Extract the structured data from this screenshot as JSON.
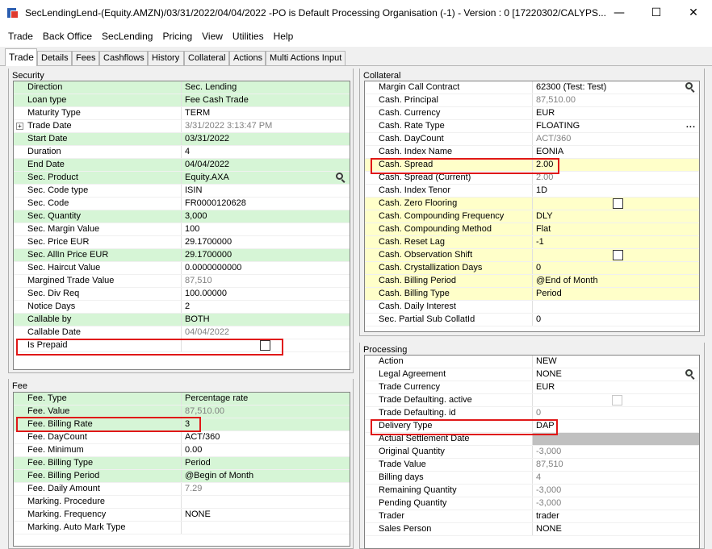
{
  "window": {
    "title": "SecLendingLend-(Equity.AMZN)/03/31/2022/04/04/2022  -PO is Default Processing Organisation  (-1) - Version : 0  [17220302/CALYPS...",
    "minimize_glyph": "—",
    "maximize_glyph": "☐",
    "close_glyph": "✕"
  },
  "menu": [
    "Trade",
    "Back Office",
    "SecLending",
    "Pricing",
    "View",
    "Utilities",
    "Help"
  ],
  "tabs": [
    "Trade",
    "Details",
    "Fees",
    "Cashflows",
    "History",
    "Collateral",
    "Actions",
    "Multi Actions Input"
  ],
  "security": {
    "title": "Security",
    "rows": [
      {
        "label": "Direction",
        "value": "Sec. Lending"
      },
      {
        "label": "Loan type",
        "value": "Fee Cash Trade"
      },
      {
        "label": "Maturity Type",
        "value": "TERM"
      },
      {
        "label": "Trade Date",
        "value": "3/31/2022 3:13:47 PM"
      },
      {
        "label": "Start Date",
        "value": "03/31/2022"
      },
      {
        "label": "Duration",
        "value": "4"
      },
      {
        "label": "End Date",
        "value": "04/04/2022"
      },
      {
        "label": "Sec. Product",
        "value": "Equity.AXA"
      },
      {
        "label": "Sec. Code type",
        "value": "ISIN"
      },
      {
        "label": "Sec. Code",
        "value": "FR0000120628"
      },
      {
        "label": "Sec. Quantity",
        "value": "3,000"
      },
      {
        "label": "Sec. Margin Value",
        "value": "100"
      },
      {
        "label": "Sec. Price EUR",
        "value": "29.1700000"
      },
      {
        "label": "Sec. AllIn Price EUR",
        "value": "29.1700000"
      },
      {
        "label": "Sec. Haircut Value",
        "value": "0.0000000000"
      },
      {
        "label": "Margined Trade Value",
        "value": "87,510"
      },
      {
        "label": "Sec. Div Req",
        "value": "100.00000"
      },
      {
        "label": "Notice Days",
        "value": "2"
      },
      {
        "label": "Callable by",
        "value": "BOTH"
      },
      {
        "label": "Callable Date",
        "value": "04/04/2022"
      },
      {
        "label": "Is Prepaid",
        "value": ""
      }
    ],
    "trade_date_expander": "+"
  },
  "fee": {
    "title": "Fee",
    "rows": [
      {
        "label": "Fee. Type",
        "value": "Percentage rate"
      },
      {
        "label": "Fee. Value",
        "value": "87,510.00"
      },
      {
        "label": "Fee. Billing Rate",
        "value": "3"
      },
      {
        "label": "Fee. DayCount",
        "value": "ACT/360"
      },
      {
        "label": "Fee. Minimum",
        "value": "0.00"
      },
      {
        "label": "Fee. Billing Type",
        "value": "Period"
      },
      {
        "label": "Fee. Billing Period",
        "value": "@Begin of Month"
      },
      {
        "label": "Fee. Daily Amount",
        "value": "7.29"
      },
      {
        "label": "Marking. Procedure",
        "value": ""
      },
      {
        "label": "Marking. Frequency",
        "value": "NONE"
      },
      {
        "label": "Marking. Auto Mark Type",
        "value": ""
      }
    ]
  },
  "collateral": {
    "title": "Collateral",
    "rows": [
      {
        "label": "Margin Call Contract",
        "value": "62300 (Test: Test)"
      },
      {
        "label": "Cash. Principal",
        "value": "87,510.00"
      },
      {
        "label": "Cash. Currency",
        "value": "EUR"
      },
      {
        "label": "Cash. Rate Type",
        "value": "FLOATING"
      },
      {
        "label": "Cash. DayCount",
        "value": "ACT/360"
      },
      {
        "label": "Cash. Index Name",
        "value": "EONIA"
      },
      {
        "label": "Cash. Spread",
        "value": "2.00"
      },
      {
        "label": "Cash. Spread (Current)",
        "value": "2.00"
      },
      {
        "label": "Cash. Index Tenor",
        "value": "1D"
      },
      {
        "label": "Cash. Zero Flooring",
        "value": ""
      },
      {
        "label": "Cash. Compounding Frequency",
        "value": "DLY"
      },
      {
        "label": "Cash. Compounding Method",
        "value": "Flat"
      },
      {
        "label": "Cash. Reset Lag",
        "value": "-1"
      },
      {
        "label": "Cash. Observation Shift",
        "value": ""
      },
      {
        "label": "Cash. Crystallization Days",
        "value": "0"
      },
      {
        "label": "Cash. Billing Period",
        "value": "@End of Month"
      },
      {
        "label": "Cash. Billing Type",
        "value": "Period"
      },
      {
        "label": "Cash. Daily Interest",
        "value": ""
      },
      {
        "label": "Sec. Partial Sub CollatId",
        "value": "0"
      }
    ],
    "ellipsis": "..."
  },
  "processing": {
    "title": "Processing",
    "rows": [
      {
        "label": "Action",
        "value": "NEW"
      },
      {
        "label": "Legal Agreement",
        "value": "NONE"
      },
      {
        "label": "Trade Currency",
        "value": "EUR"
      },
      {
        "label": "Trade Defaulting. active",
        "value": ""
      },
      {
        "label": "Trade Defaulting. id",
        "value": "0"
      },
      {
        "label": "Delivery Type",
        "value": "DAP"
      },
      {
        "label": "Actual Settlement Date",
        "value": ""
      },
      {
        "label": "Original Quantity",
        "value": "-3,000"
      },
      {
        "label": "Trade Value",
        "value": "87,510"
      },
      {
        "label": "Billing days",
        "value": "4"
      },
      {
        "label": "Remaining Quantity",
        "value": "-3,000"
      },
      {
        "label": "Pending Quantity",
        "value": "-3,000"
      },
      {
        "label": "Trader",
        "value": "trader"
      },
      {
        "label": "Sales Person",
        "value": "NONE"
      }
    ]
  },
  "colors": {
    "green_row": "#d6f5d6",
    "yellow_row": "#ffffc9",
    "highlight": "#e01818"
  }
}
